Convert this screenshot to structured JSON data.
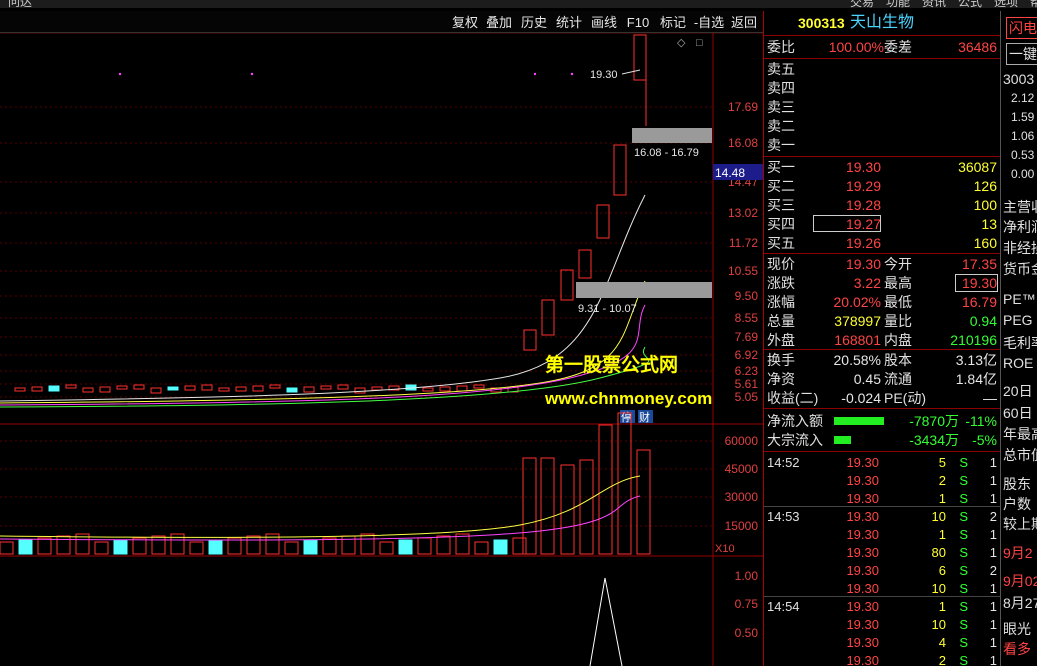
{
  "top_menu": [
    "问达",
    "交易",
    "功能",
    "资讯",
    "公式",
    "选项",
    "帮助"
  ],
  "toolbar": {
    "buttons": [
      "复权",
      "叠加",
      "历史",
      "统计",
      "画线",
      "F10",
      "标记",
      "-自选",
      "返回"
    ]
  },
  "kchart": {
    "y_ticks": [
      "17.69",
      "16.08",
      "14.47",
      "13.02",
      "11.72",
      "10.55",
      "9.50",
      "8.55",
      "7.69",
      "6.92",
      "6.23",
      "5.61",
      "5.05"
    ],
    "current_price_tag": "14.48",
    "high_label": "19.30",
    "gap_upper_label": "16.08 - 16.79",
    "gap_lower_label": "9.31 - 10.07",
    "watermark_cn": "第一股票公式网",
    "watermark_url": "www.chnmoney.com",
    "badges": [
      "停",
      "财"
    ]
  },
  "volume_chart": {
    "y_ticks": [
      "60000",
      "45000",
      "30000",
      "15000"
    ],
    "unit": "X10"
  },
  "indicator_chart": {
    "y_ticks": [
      "1.00",
      "0.75",
      "0.50"
    ]
  },
  "quote": {
    "code": "300313",
    "name": "天山生物",
    "weibi_label": "委比",
    "weibi": "100.00%",
    "weicha_label": "委差",
    "weicha": "36486",
    "asks": [
      {
        "label": "卖五",
        "price": "",
        "vol": ""
      },
      {
        "label": "卖四",
        "price": "",
        "vol": ""
      },
      {
        "label": "卖三",
        "price": "",
        "vol": ""
      },
      {
        "label": "卖二",
        "price": "",
        "vol": ""
      },
      {
        "label": "卖一",
        "price": "",
        "vol": ""
      }
    ],
    "bids": [
      {
        "label": "买一",
        "price": "19.30",
        "vol": "36087"
      },
      {
        "label": "买二",
        "price": "19.29",
        "vol": "126"
      },
      {
        "label": "买三",
        "price": "19.28",
        "vol": "100"
      },
      {
        "label": "买四",
        "price": "19.27",
        "vol": "13"
      },
      {
        "label": "买五",
        "price": "19.26",
        "vol": "160"
      }
    ],
    "stats": [
      {
        "l1": "现价",
        "v1": "19.30",
        "l2": "今开",
        "v2": "17.35"
      },
      {
        "l1": "涨跌",
        "v1": "3.22",
        "l2": "最高",
        "v2": "19.30"
      },
      {
        "l1": "涨幅",
        "v1": "20.02%",
        "l2": "最低",
        "v2": "16.79"
      },
      {
        "l1": "总量",
        "v1": "378997",
        "l2": "量比",
        "v2": "0.94"
      },
      {
        "l1": "外盘",
        "v1": "168801",
        "l2": "内盘",
        "v2": "210196"
      }
    ],
    "stats2": [
      {
        "l1": "换手",
        "v1": "20.58%",
        "l2": "股本",
        "v2": "3.13亿"
      },
      {
        "l1": "净资",
        "v1": "0.45",
        "l2": "流通",
        "v2": "1.84亿"
      },
      {
        "l1": "收益(二)",
        "v1": "-0.024",
        "l2": "PE(动)",
        "v2": "—"
      }
    ],
    "flows": [
      {
        "label": "净流入额",
        "value": "-7870万",
        "pct": "-11%",
        "bar": 0.9
      },
      {
        "label": "大宗流入",
        "value": "-3434万",
        "pct": "-5%",
        "bar": 0.3
      }
    ],
    "ticks": [
      {
        "time": "14:52",
        "price": "19.30",
        "vol": "5",
        "side": "S",
        "n": "1"
      },
      {
        "time": "",
        "price": "19.30",
        "vol": "2",
        "side": "S",
        "n": "1"
      },
      {
        "time": "",
        "price": "19.30",
        "vol": "1",
        "side": "S",
        "n": "1"
      },
      {
        "time": "14:53",
        "price": "19.30",
        "vol": "10",
        "side": "S",
        "n": "2"
      },
      {
        "time": "",
        "price": "19.30",
        "vol": "1",
        "side": "S",
        "n": "1"
      },
      {
        "time": "",
        "price": "19.30",
        "vol": "80",
        "side": "S",
        "n": "1"
      },
      {
        "time": "",
        "price": "19.30",
        "vol": "6",
        "side": "S",
        "n": "2"
      },
      {
        "time": "",
        "price": "19.30",
        "vol": "10",
        "side": "S",
        "n": "1"
      },
      {
        "time": "14:54",
        "price": "19.30",
        "vol": "1",
        "side": "S",
        "n": "1"
      },
      {
        "time": "",
        "price": "19.30",
        "vol": "10",
        "side": "S",
        "n": "1"
      },
      {
        "time": "",
        "price": "19.30",
        "vol": "4",
        "side": "S",
        "n": "1"
      },
      {
        "time": "",
        "price": "19.30",
        "vol": "2",
        "side": "S",
        "n": "1"
      }
    ]
  },
  "far_right": {
    "btn1": "闪电",
    "btn2": "一键",
    "code": "3003",
    "nums": [
      "2.12",
      "1.59",
      "1.06",
      "0.53",
      "0.00"
    ],
    "labels": [
      "主营收",
      "净利润",
      "非经损",
      "货币金",
      "PE™",
      "PEG",
      "毛利率",
      "ROE",
      "20日",
      "60日",
      "年最高",
      "总市值",
      "股东",
      "户数",
      "较上期",
      "9月2",
      "9月02",
      "8月27",
      "眼光",
      "看多"
    ]
  }
}
